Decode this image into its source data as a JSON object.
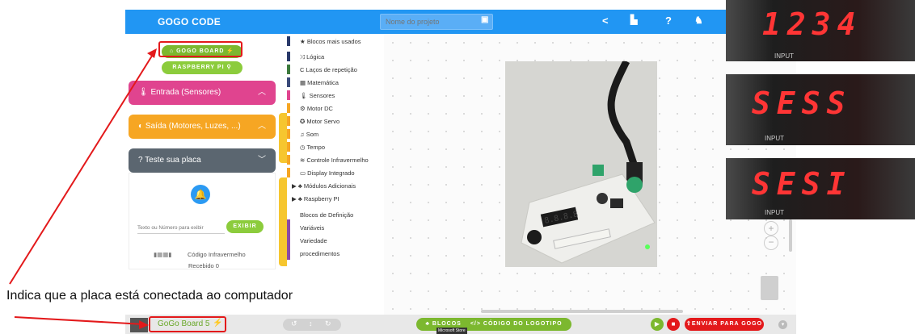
{
  "app": {
    "title": "GOGO CODE"
  },
  "topbar": {
    "project_placeholder": "Nome do projeto"
  },
  "board_buttons": {
    "gogo_board": "GOGO BOARD",
    "raspberry_pi": "RASPBERRY PI"
  },
  "categories": {
    "input": "Entrada (Sensores)",
    "output": "Saída (Motores, Luzes, ...)",
    "test": "Teste sua placa"
  },
  "test_panel": {
    "input_placeholder": "Texto ou Número para exibir",
    "show_button": "EXIBIR",
    "ir_label": "Código Infravermelho",
    "received_label": "Recebido 0"
  },
  "blocks": [
    "Blocos mais usados",
    "Lógica",
    "Laços de repetição",
    "Matemática",
    "Sensores",
    "Motor DC",
    "Motor Servo",
    "Som",
    "Tempo",
    "Controle Infravermelho",
    "Display Integrado",
    "Módulos Adicionais",
    "Raspberry PI",
    "Blocos de Definição",
    "Variáveis",
    "Variedade",
    "procedimentos"
  ],
  "bottombar": {
    "board_status": "GoGo Board 5",
    "blocks_tab": "BLOCOS",
    "logo_tab": "CÓDIGO DO LOGOTIPO",
    "send_button": "ENVIAR PARA GOGO",
    "tooltip": "Microsoft Store"
  },
  "annotation": {
    "text": "Indica que a placa está conectada ao computador"
  },
  "photos": {
    "display1": "1234",
    "display2": "SESS",
    "display3": "SESI",
    "label": "INPUT"
  },
  "colors": {
    "topbar": "#2196f3",
    "gogo_green": "#7cb82f",
    "input_pink": "#e0448f",
    "output_orange": "#f6a623",
    "test_gray": "#5b6670",
    "annotation_red": "#e3191b"
  }
}
